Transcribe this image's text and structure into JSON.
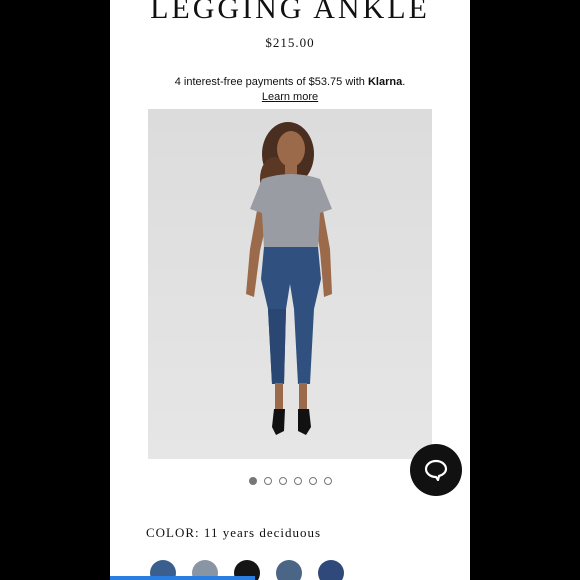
{
  "product": {
    "title": "LEGGING ANKLE",
    "price": "$215.00"
  },
  "payments": {
    "text_prefix": "4 interest-free payments of $53.75 with ",
    "provider": "Klarna",
    "text_suffix": ".",
    "learn_more": "Learn more"
  },
  "gallery": {
    "image_alt": "Model wearing gray tee and blue skinny ankle jeans",
    "dots_count": 6,
    "active_index": 0
  },
  "color": {
    "label": "COLOR:",
    "value": "11 years deciduous",
    "swatches": [
      "#3a5f8f",
      "#8a95a3",
      "#151515",
      "#4a6585",
      "#2f4a7a"
    ]
  },
  "chat": {
    "icon": "chat-bubble-icon"
  }
}
